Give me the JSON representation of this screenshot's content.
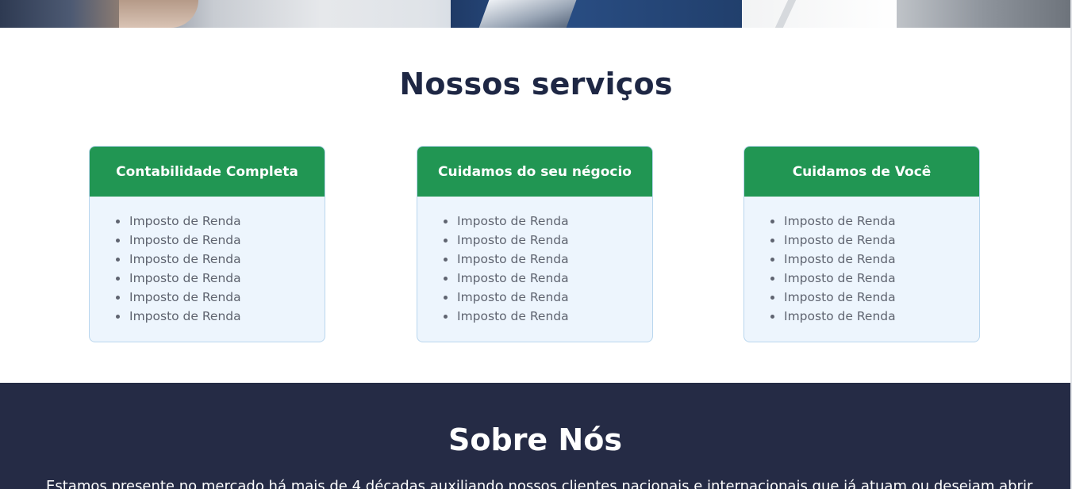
{
  "hero": {
    "image": "business-meeting-photo"
  },
  "services": {
    "title": "Nossos serviços",
    "cards": [
      {
        "title": "Contabilidade Completa",
        "items": [
          "Imposto de Renda",
          "Imposto de Renda",
          "Imposto de Renda",
          "Imposto de Renda",
          "Imposto de Renda",
          "Imposto de Renda"
        ]
      },
      {
        "title": "Cuidamos do seu négocio",
        "items": [
          "Imposto de Renda",
          "Imposto de Renda",
          "Imposto de Renda",
          "Imposto de Renda",
          "Imposto de Renda",
          "Imposto de Renda"
        ]
      },
      {
        "title": "Cuidamos de Você",
        "items": [
          "Imposto de Renda",
          "Imposto de Renda",
          "Imposto de Renda",
          "Imposto de Renda",
          "Imposto de Renda",
          "Imposto de Renda"
        ]
      }
    ]
  },
  "about": {
    "title": "Sobre Nós",
    "text": "Estamos presente no mercado há mais de 4 décadas auxiliando nossos clientes nacionais e internacionais que já atuam ou desejam abrir"
  },
  "colors": {
    "card_header": "#219653",
    "card_body": "#edf5fd",
    "heading": "#1e2744",
    "about_bg": "#252b45"
  }
}
